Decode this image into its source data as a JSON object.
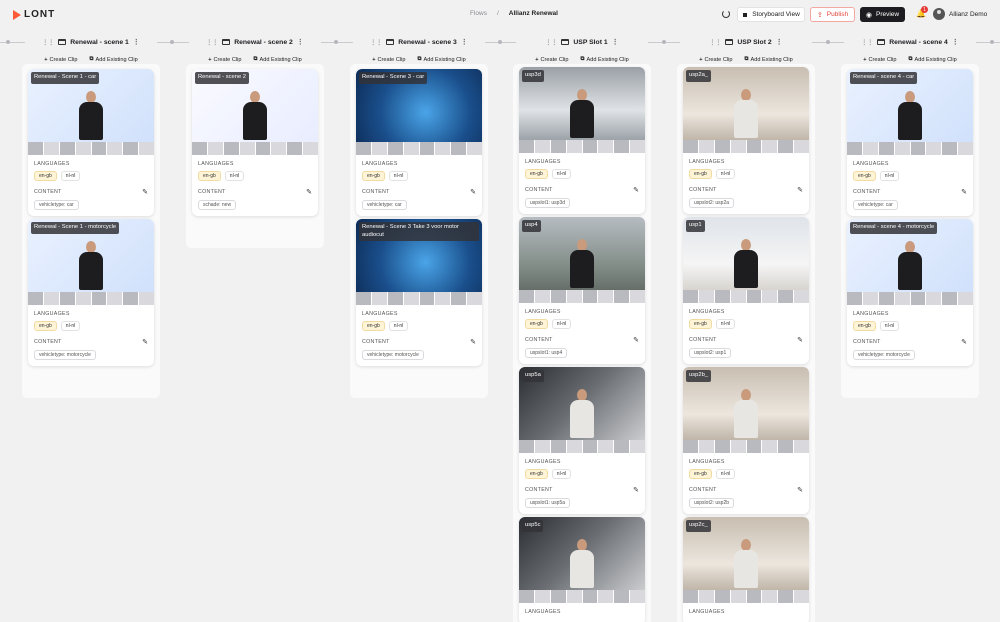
{
  "app": {
    "logo": "LONT"
  },
  "breadcrumb": {
    "flows": "Flows",
    "sep": "/",
    "current": "Allianz Renewal"
  },
  "toolbar": {
    "storyboard": "Storyboard View",
    "publish": "Publish",
    "preview": "Preview",
    "notifications": "1",
    "user": "Allianz Demo"
  },
  "labels": {
    "create_clip": "Create Clip",
    "add_existing": "Add Existing Clip",
    "languages": "LANGUAGES",
    "content": "CONTENT"
  },
  "colors": {
    "accent": "#ff5a36",
    "publish": "#e0453a",
    "dark": "#1d1d21"
  },
  "columns": [
    {
      "title": "Renewal - scene 1",
      "cards": [
        {
          "label": "Renewal - Scene 1 - car",
          "langs": [
            "en-gb",
            "nl-nl"
          ],
          "tag": "vehicletype: car",
          "bg": "bg-blue",
          "person": "dark"
        },
        {
          "label": "Renewal - Scene 1 - motorcycle",
          "langs": [
            "en-gb",
            "nl-nl"
          ],
          "tag": "vehicletype: motorcycle",
          "bg": "bg-blue",
          "person": "dark"
        }
      ]
    },
    {
      "title": "Renewal - scene 2",
      "cards": [
        {
          "label": "Renewal - scene 2",
          "langs": [
            "en-gb",
            "nl-nl"
          ],
          "tag": "schade: new",
          "bg": "bg-white",
          "person": "dark"
        }
      ]
    },
    {
      "title": "Renewal - scene 3",
      "cards": [
        {
          "label": "Renewal - Scene 3 - car",
          "langs": [
            "en-gb",
            "nl-nl"
          ],
          "tag": "vehicletype: car",
          "bg": "bg-tech",
          "person": "none"
        },
        {
          "label": "Renewal - Scene 3 Take 3 voor motor audiocut",
          "langs": [
            "en-gb",
            "nl-nl"
          ],
          "tag": "vehicletype: motorcycle",
          "bg": "bg-tech",
          "person": "none"
        }
      ]
    },
    {
      "title": "USP Slot 1",
      "cards": [
        {
          "label": "usp3d",
          "langs": [
            "en-gb",
            "nl-nl"
          ],
          "tag": "uspslot1: usp3d",
          "bg": "bg-office",
          "person": "dark"
        },
        {
          "label": "usp4",
          "langs": [
            "en-gb",
            "nl-nl"
          ],
          "tag": "uspslot1: usp4",
          "bg": "bg-street",
          "person": "dark"
        },
        {
          "label": "usp5a",
          "langs": [
            "en-gb",
            "nl-nl"
          ],
          "tag": "uspslot1: usp5a",
          "bg": "bg-car",
          "person": "light"
        },
        {
          "label": "usp5c",
          "langs": [],
          "tag": "",
          "bg": "bg-car",
          "person": "light"
        }
      ]
    },
    {
      "title": "USP Slot 2",
      "cards": [
        {
          "label": "usp2a_",
          "langs": [
            "en-gb",
            "nl-nl"
          ],
          "tag": "uspslot2: usp2a",
          "bg": "bg-cafe",
          "person": "light"
        },
        {
          "label": "usp1",
          "langs": [
            "en-gb",
            "nl-nl"
          ],
          "tag": "uspslot2: usp1",
          "bg": "bg-room",
          "person": "dark"
        },
        {
          "label": "usp2b_",
          "langs": [
            "en-gb",
            "nl-nl"
          ],
          "tag": "uspslot2: usp2b",
          "bg": "bg-cafe",
          "person": "light"
        },
        {
          "label": "usp2c_",
          "langs": [],
          "tag": "",
          "bg": "bg-cafe",
          "person": "light"
        }
      ]
    },
    {
      "title": "Renewal - scene 4",
      "cards": [
        {
          "label": "Renewal - scene 4 - car",
          "langs": [
            "en-gb",
            "nl-nl"
          ],
          "tag": "vehicletype: car",
          "bg": "bg-blue",
          "person": "dark"
        },
        {
          "label": "Renewal - scene 4 - motorcycle",
          "langs": [
            "en-gb",
            "nl-nl"
          ],
          "tag": "vehicletype: motorcycle",
          "bg": "bg-blue",
          "person": "dark"
        }
      ]
    }
  ]
}
